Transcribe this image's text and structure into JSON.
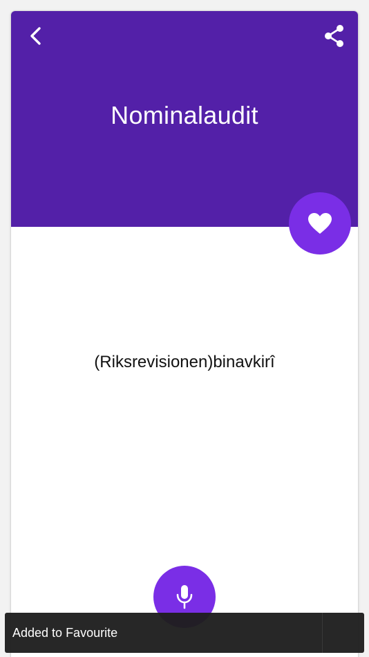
{
  "colors": {
    "header_bg": "#5320a8",
    "accent": "#7a2ee6",
    "snackbar_bg": "#1e1e1e",
    "text_dark": "#111111",
    "text_light": "#ffffff"
  },
  "header": {
    "back_icon": "chevron-left-icon",
    "share_icon": "share-icon",
    "title": "Nominalaudit"
  },
  "favourite": {
    "icon": "heart-icon"
  },
  "content": {
    "translation": "(Riksrevisionen)binavkirî"
  },
  "mic": {
    "icon": "microphone-icon"
  },
  "snackbar": {
    "message": "Added to Favourite"
  }
}
